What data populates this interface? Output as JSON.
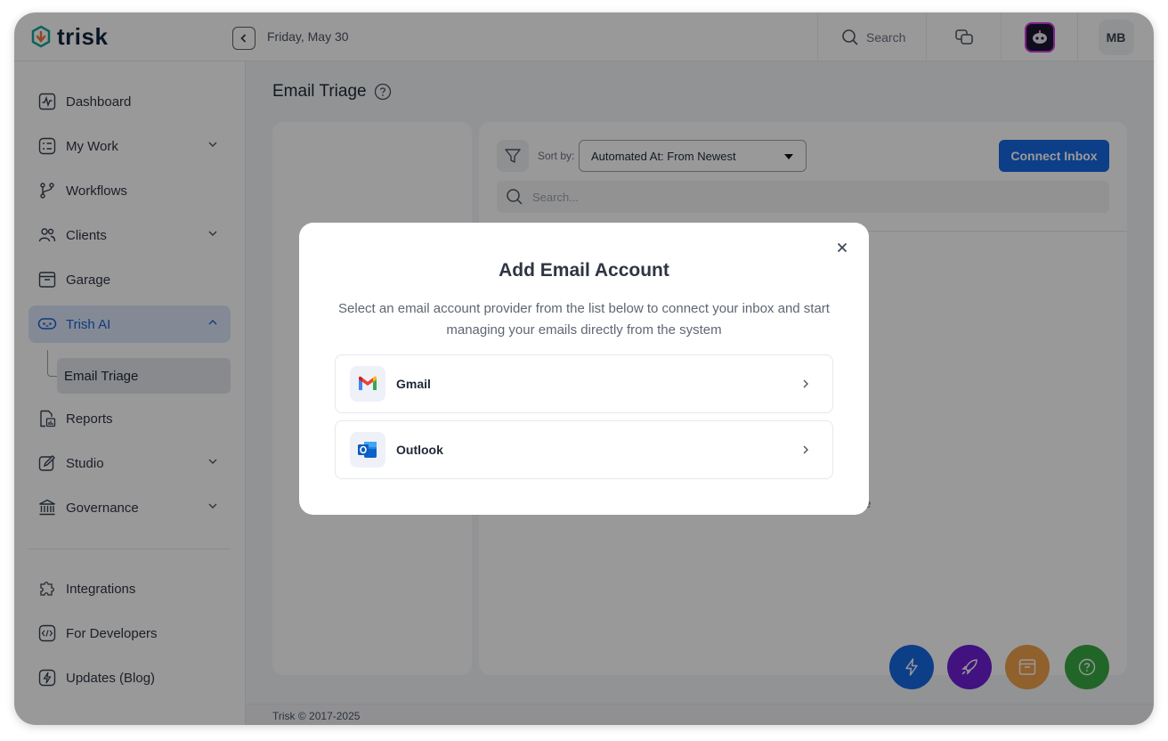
{
  "app": {
    "name": "trisk"
  },
  "header": {
    "date": "Friday, May 30",
    "search_label": "Search",
    "user_initials": "MB"
  },
  "sidebar": {
    "items": [
      {
        "label": "Dashboard",
        "icon": "activity-icon"
      },
      {
        "label": "My Work",
        "icon": "checklist-icon",
        "expandable": true
      },
      {
        "label": "Workflows",
        "icon": "git-branch-icon"
      },
      {
        "label": "Clients",
        "icon": "users-icon",
        "expandable": true
      },
      {
        "label": "Garage",
        "icon": "archive-icon"
      },
      {
        "label": "Trish AI",
        "icon": "bot-icon",
        "expandable": true,
        "active": true
      },
      {
        "label": "Reports",
        "icon": "report-icon"
      },
      {
        "label": "Studio",
        "icon": "pencil-icon",
        "expandable": true
      },
      {
        "label": "Governance",
        "icon": "bank-icon",
        "expandable": true
      }
    ],
    "sub_item": "Email Triage",
    "bottom_items": [
      {
        "label": "Integrations",
        "icon": "puzzle-icon"
      },
      {
        "label": "For Developers",
        "icon": "code-icon"
      },
      {
        "label": "Updates (Blog)",
        "icon": "bolt-icon"
      }
    ]
  },
  "main": {
    "title": "Email Triage",
    "sort_label": "Sort by:",
    "sort_value": "Automated At: From Newest",
    "connect_button": "Connect Inbox",
    "search_placeholder": "Search...",
    "empty_text_fragment": "re"
  },
  "footer": {
    "text": "Trisk © 2017-2025"
  },
  "modal": {
    "title": "Add Email Account",
    "description": "Select an email account provider from the list below to connect your inbox and start managing your emails directly from the system",
    "providers": [
      {
        "name": "Gmail",
        "icon": "gmail-icon"
      },
      {
        "name": "Outlook",
        "icon": "outlook-icon"
      }
    ]
  },
  "colors": {
    "accent": "#1668e3",
    "active_nav_bg": "#dbe7fb",
    "fab_blue": "#1668e3",
    "fab_purple": "#6d1fd6",
    "fab_orange": "#f0a04b",
    "fab_green": "#3aa844"
  }
}
